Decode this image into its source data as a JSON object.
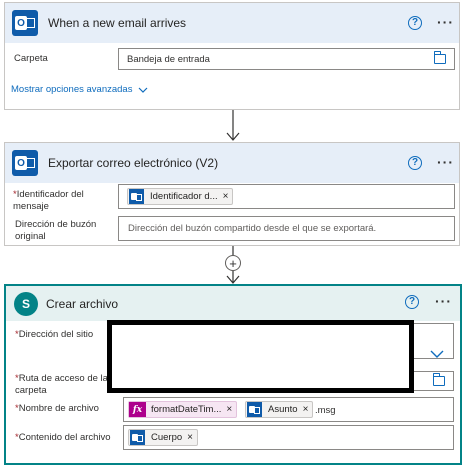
{
  "card1": {
    "title": "When a new email arrives",
    "folder_label": "Carpeta",
    "folder_value": "Bandeja de entrada",
    "advanced_link": "Mostrar opciones avanzadas",
    "help": "?",
    "more": "···"
  },
  "card2": {
    "title": "Exportar correo electrónico (V2)",
    "msgid_label_1": "Identificador del",
    "msgid_label_2": "mensaje",
    "msgid_token": "Identificador d...",
    "mailbox_label_1": "Dirección de buzón",
    "mailbox_label_2": "original",
    "mailbox_placeholder": "Dirección del buzón compartido desde el que se exportará.",
    "help": "?",
    "more": "···"
  },
  "connector": {
    "plus": "+"
  },
  "card3": {
    "title": "Crear archivo",
    "site_label": "Dirección del sitio",
    "path_label_1": "Ruta de acceso de la",
    "path_label_2": "carpeta",
    "filename_label": "Nombre de archivo",
    "filename_fx_token": "formatDateTim...",
    "filename_subject_token": "Asunto",
    "filename_suffix": ".msg",
    "content_label": "Contenido del archivo",
    "content_token": "Cuerpo",
    "help": "?",
    "more": "···",
    "required_mark": "*",
    "fx": "fx",
    "sp_letter": "S",
    "x": "×"
  },
  "colors": {
    "card1_header": "#e6eef8",
    "card2_header": "#e6eef8",
    "card3_header": "#e5f1f1",
    "outlook_blue": "#0f5ba9",
    "sharepoint_teal": "#038387",
    "link_blue": "#0f6cbd",
    "fx_pink": "#ad008c"
  }
}
